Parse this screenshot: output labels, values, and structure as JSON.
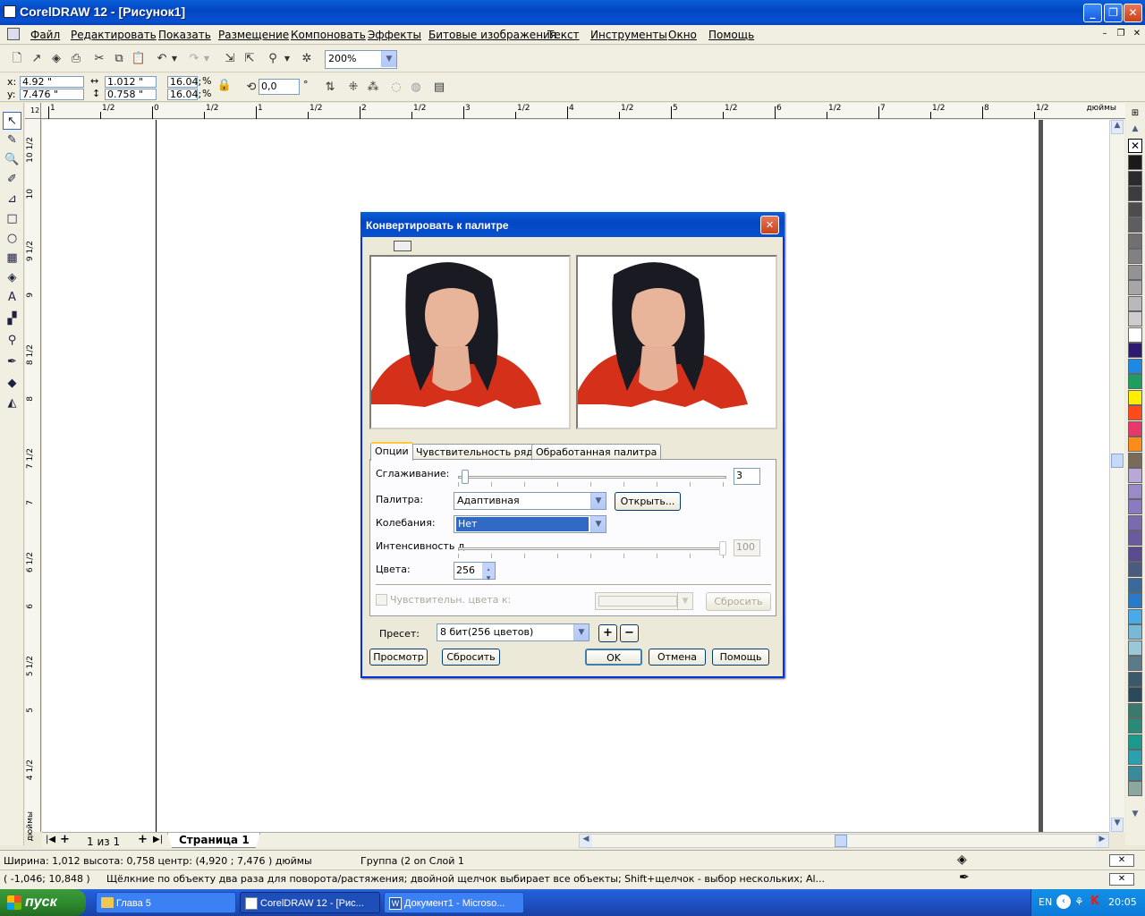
{
  "window": {
    "title": "CorelDRAW 12 - [Рисунок1]"
  },
  "menu": [
    "Файл",
    "Редактировать",
    "Показать",
    "Размещение",
    "Компоновать",
    "Эффекты",
    "Битовые изображения",
    "Текст",
    "Инструменты",
    "Окно",
    "Помощь"
  ],
  "toolbar": {
    "zoom": "200%"
  },
  "propbar": {
    "x_label": "x:",
    "x": "4.92 \"",
    "y_label": "y:",
    "y": "7.476 \"",
    "width": "1.012 \"",
    "height": "0.758 \"",
    "scale_w": "16.04;",
    "scale_h": "16.04;",
    "pct": "%",
    "angle": "0,0",
    "deg": "°"
  },
  "ruler": {
    "unit": "дюймы",
    "h_ticks": [
      "1",
      "1/2",
      "0",
      "1/2",
      "1",
      "1/2",
      "2",
      "1/2",
      "3",
      "1/2",
      "4",
      "1/2",
      "5",
      "1/2",
      "6",
      "1/2",
      "7",
      "1/2",
      "8",
      "1/2"
    ],
    "v_ticks": [
      "10 1/2",
      "10",
      "9 1/2",
      "9",
      "8 1/2",
      "8",
      "7 1/2",
      "7",
      "6 1/2",
      "6",
      "5 1/2",
      "5",
      "4 1/2",
      "дюймы"
    ],
    "corner": "12"
  },
  "pages": {
    "counter": "1 из 1",
    "tab": "Страница 1"
  },
  "dialog": {
    "title": "Конвертировать к палитре",
    "tabs": [
      "Опции",
      "Чувствительность ряда",
      "Обработанная палитра"
    ],
    "smoothing_label": "Сглаживание:",
    "smoothing_value": "3",
    "palette_label": "Палитра:",
    "palette_value": "Адаптивная",
    "open_button": "Открыть...",
    "dither_label": "Колебания:",
    "dither_value": "Нет",
    "intensity_label": "Интенсивность д",
    "intensity_value": "100",
    "colors_label": "Цвета:",
    "colors_value": "256",
    "sensitive_label": "Чувствительн. цвета к:",
    "reset_inner": "Сбросить",
    "preset_label": "Пресет:",
    "preset_value": "8 бит(256 цветов)",
    "preview_button": "Просмотр",
    "reset_button": "Сбросить",
    "ok": "OK",
    "cancel": "Отмена",
    "help": "Помощь"
  },
  "status": {
    "line1": "Ширина: 1,012   высота: 0,758   центр: (4,920 ; 7,476 )  дюймы",
    "group": "Группа (2 on Слой 1",
    "coords": "( -1,046; 10,848 )",
    "hint": "Щёлкние по объекту два раза для поворота/растяжения; двойной щелчок выбирает все объекты; Shift+щелчок - выбор нескольких; Al..."
  },
  "taskbar": {
    "start": "пуск",
    "tasks": [
      "Глава 5",
      "CorelDRAW 12 - [Рис...",
      "Документ1 - Microso..."
    ],
    "lang": "EN",
    "clock": "20:05"
  },
  "palette_colors": [
    "#1a1a1a",
    "#2b2b2b",
    "#3c3c3c",
    "#4d4d4d",
    "#5e5e5e",
    "#707070",
    "#818181",
    "#939393",
    "#a6a6a6",
    "#b9b9b9",
    "#cccccc",
    "#ffffff",
    "#2e1a6e",
    "#1e88e5",
    "#1e9e5e",
    "#ffee00",
    "#ff4a1a",
    "#e8386a",
    "#ff8c1a",
    "#7a6a5a",
    "#b8a8d8",
    "#9a8ac8",
    "#8a7abf",
    "#7a6ab0",
    "#6a5aa0",
    "#5a4a90",
    "#4a5a80",
    "#3a6a9a",
    "#2a7aca",
    "#4aaae8",
    "#7ab8d8",
    "#9ac8d8",
    "#5a7a8a",
    "#3a5a6a",
    "#2a4a5a",
    "#3a7a6a",
    "#2a8a7a",
    "#1a9a8a",
    "#2aa0b0",
    "#3a8a9a",
    "#8aa8a0"
  ]
}
